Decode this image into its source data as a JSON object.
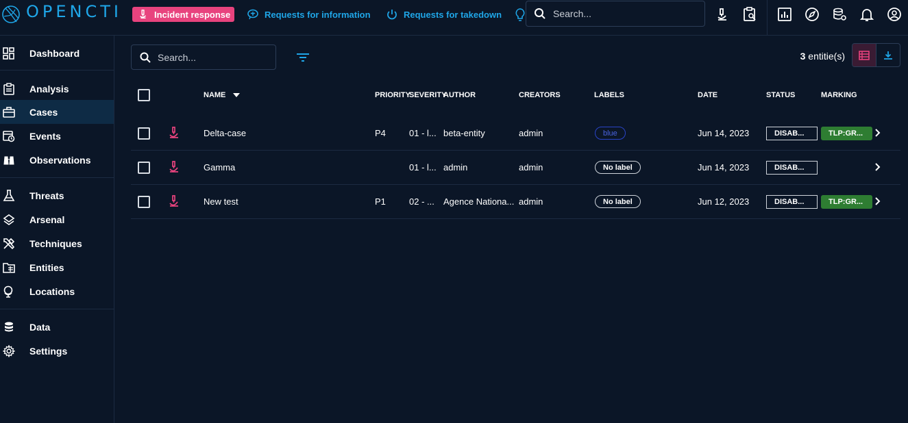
{
  "app": {
    "name": "OPENCTI",
    "accent": "#1fa6e8",
    "active_color": "#e8437e"
  },
  "topnav": [
    {
      "label": "Incident response",
      "icon": "microscope-icon",
      "active": true
    },
    {
      "label": "Requests for information",
      "icon": "brain-icon",
      "active": false
    },
    {
      "label": "Requests for takedown",
      "icon": "power-icon",
      "active": false
    }
  ],
  "top_search": {
    "placeholder": "Search..."
  },
  "sidebar": {
    "items": [
      {
        "label": "Dashboard",
        "icon": "dashboard-icon"
      },
      {
        "label": "Analysis",
        "icon": "clipboard-icon"
      },
      {
        "label": "Cases",
        "icon": "briefcase-icon",
        "active": true
      },
      {
        "label": "Events",
        "icon": "calendar-clock-icon"
      },
      {
        "label": "Observations",
        "icon": "binoculars-icon"
      },
      {
        "label": "Threats",
        "icon": "flask-icon"
      },
      {
        "label": "Arsenal",
        "icon": "layers-icon"
      },
      {
        "label": "Techniques",
        "icon": "tools-icon"
      },
      {
        "label": "Entities",
        "icon": "folder-table-icon"
      },
      {
        "label": "Locations",
        "icon": "globe-icon"
      },
      {
        "label": "Data",
        "icon": "database-icon"
      },
      {
        "label": "Settings",
        "icon": "gear-icon"
      }
    ]
  },
  "list": {
    "search_placeholder": "Search...",
    "count_value": "3",
    "count_suffix": " entitie(s)",
    "columns": {
      "name": "NAME",
      "priority": "PRIORITY",
      "severity": "SEVERITY",
      "author": "AUTHOR",
      "creators": "CREATORS",
      "labels": "LABELS",
      "date": "DATE",
      "status": "STATUS",
      "marking": "MARKING"
    },
    "rows": [
      {
        "name": "Delta-case",
        "priority": "P4",
        "severity": "01 - l...",
        "author": "beta-entity",
        "creators": "admin",
        "label": "blue",
        "label_style": "blue",
        "date": "Jun 14, 2023",
        "status": "DISAB...",
        "marking": "TLP:GR..."
      },
      {
        "name": "Gamma",
        "priority": "",
        "severity": "01 - l...",
        "author": "admin",
        "creators": "admin",
        "label": "No label",
        "label_style": "none",
        "date": "Jun 14, 2023",
        "status": "DISAB...",
        "marking": ""
      },
      {
        "name": "New test",
        "priority": "P1",
        "severity": "02 - ...",
        "author": "Agence Nationa...",
        "creators": "admin",
        "label": "No label",
        "label_style": "none",
        "date": "Jun 12, 2023",
        "status": "DISAB...",
        "marking": "TLP:GR..."
      }
    ]
  }
}
